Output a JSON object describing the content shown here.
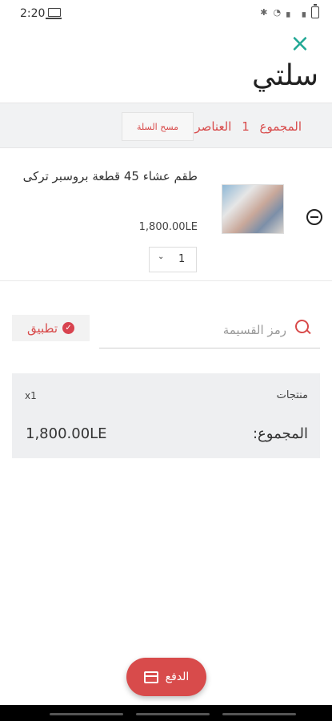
{
  "status_bar": {
    "time": "2:20"
  },
  "header": {
    "title": "سلتي"
  },
  "summary": {
    "label": "المجموع",
    "count": "1",
    "items_label": "العناصر",
    "clear_button": "مسح السلة"
  },
  "cart_item": {
    "name": "طقم عشاء 45 قطعة بروسبر تركى",
    "price": "1,800.00LE",
    "quantity": "1"
  },
  "coupon": {
    "placeholder": "رمز القسيمة",
    "apply_label": "تطبيق"
  },
  "totals": {
    "products_label": "منتجات",
    "products_count": "x1",
    "total_label": "المجموع:",
    "total_value": "1,800.00LE"
  },
  "checkout": {
    "pay_label": "الدفع"
  },
  "colors": {
    "accent": "#d84b4b",
    "close": "#21a895"
  }
}
